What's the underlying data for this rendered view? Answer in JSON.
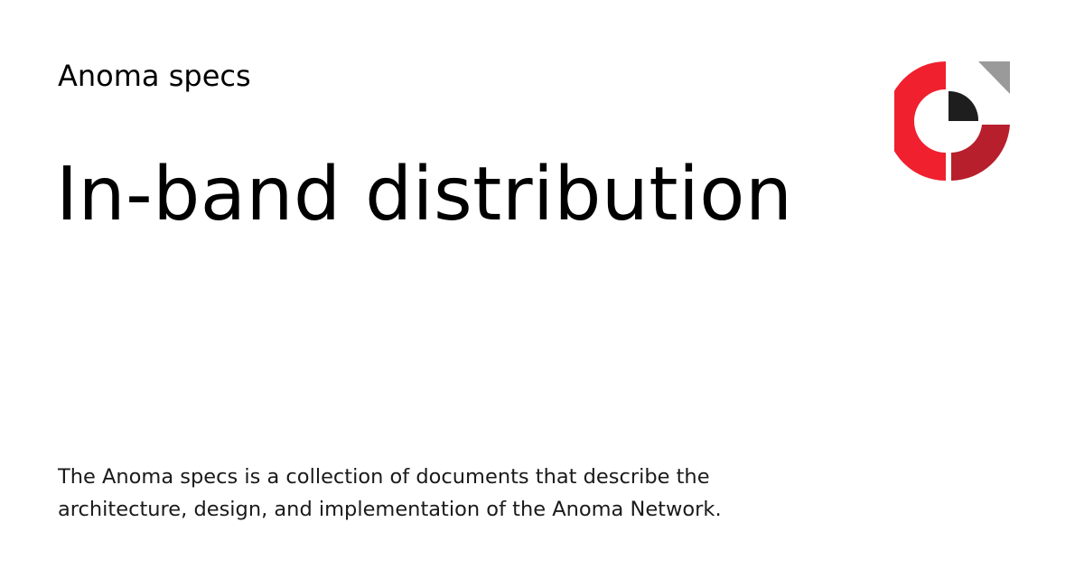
{
  "site": {
    "name": "Anoma specs"
  },
  "page": {
    "title": "In-band distribution",
    "description": "The Anoma specs is a collection of documents that describe the architecture, design, and implementation of the Anoma Network."
  },
  "logo": {
    "icon": "anoma-logo-icon",
    "colors": {
      "red": "#F0202F",
      "dark_red": "#B71F2C",
      "black": "#1E1E1E",
      "gray": "#9A9A9A"
    }
  }
}
